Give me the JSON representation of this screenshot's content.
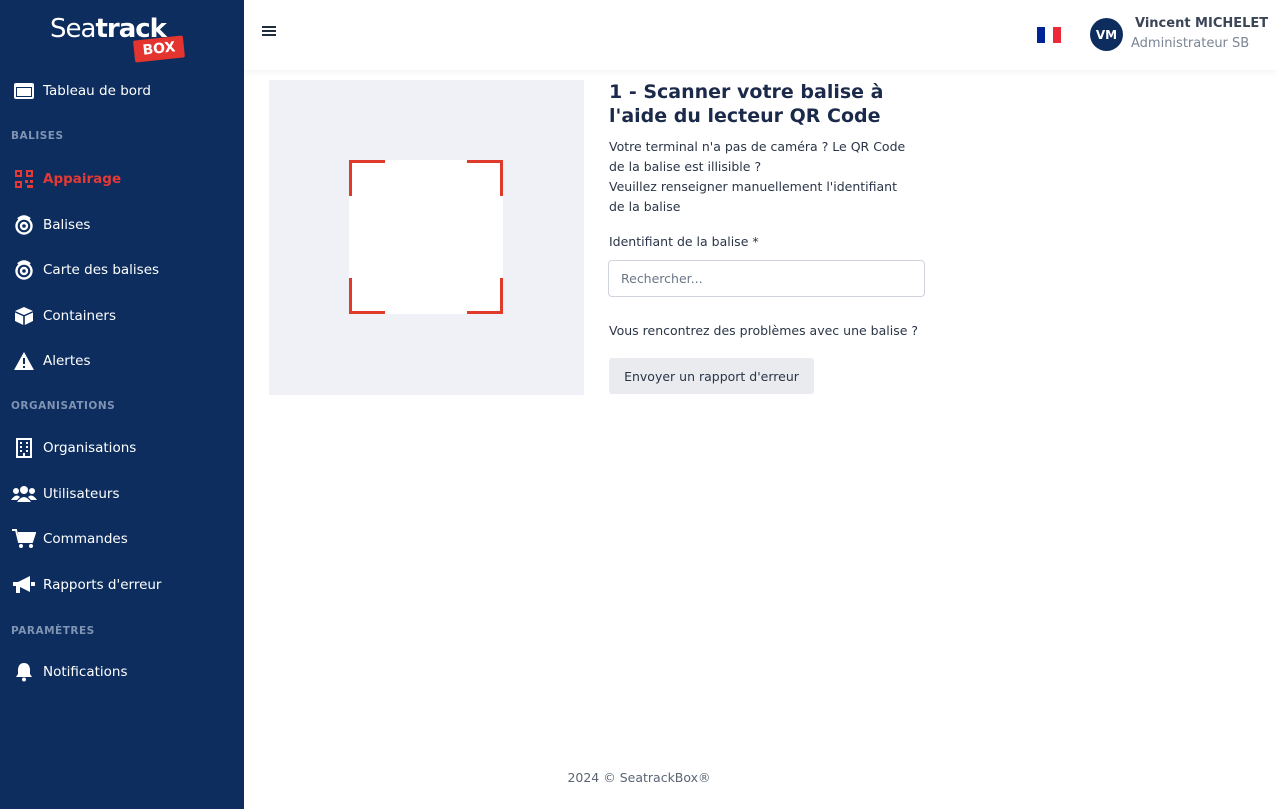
{
  "brand": {
    "part1": "Sea",
    "part2": "track",
    "badge": "BOX"
  },
  "sidebar": {
    "dashboard": "Tableau de bord",
    "sections": [
      "BALISES",
      "ORGANISATIONS",
      "PARAMÈTRES"
    ],
    "items": [
      {
        "label": "Appairage",
        "icon": "qrcode-icon",
        "active": true
      },
      {
        "label": "Balises",
        "icon": "beacon-icon"
      },
      {
        "label": "Carte des balises",
        "icon": "map-beacon-icon"
      },
      {
        "label": "Containers",
        "icon": "box-icon"
      },
      {
        "label": "Alertes",
        "icon": "alert-icon"
      },
      {
        "label": "Organisations",
        "icon": "building-icon"
      },
      {
        "label": "Utilisateurs",
        "icon": "users-icon"
      },
      {
        "label": "Commandes",
        "icon": "cart-icon"
      },
      {
        "label": "Rapports d'erreur",
        "icon": "megaphone-icon"
      },
      {
        "label": "Notifications",
        "icon": "bell-icon"
      }
    ]
  },
  "header": {
    "user_initials": "VM",
    "user_name": "Vincent MICHELET",
    "user_role": "Administrateur SB",
    "flag_colors": [
      "#002395",
      "#ffffff",
      "#ed2939"
    ]
  },
  "main": {
    "title": "1 - Scanner votre balise à l'aide du lecteur QR Code",
    "desc_lines": [
      "Votre terminal n'a pas de caméra ? Le QR Code",
      "de la balise est illisible ?",
      "Veuillez renseigner manuellement l'identifiant",
      "de la balise"
    ],
    "field_label": "Identifiant de la balise",
    "field_required": "*",
    "search_placeholder": "Rechercher...",
    "problem_text": "Vous rencontrez des problèmes avec une balise ?",
    "report_button": "Envoyer un rapport d'erreur"
  },
  "footer": {
    "text": "2024 © SeatrackBox®"
  },
  "colors": {
    "sidebar_bg": "#0c2d5e",
    "accent": "#e53935",
    "scanner_corner": "#e03a2b"
  }
}
